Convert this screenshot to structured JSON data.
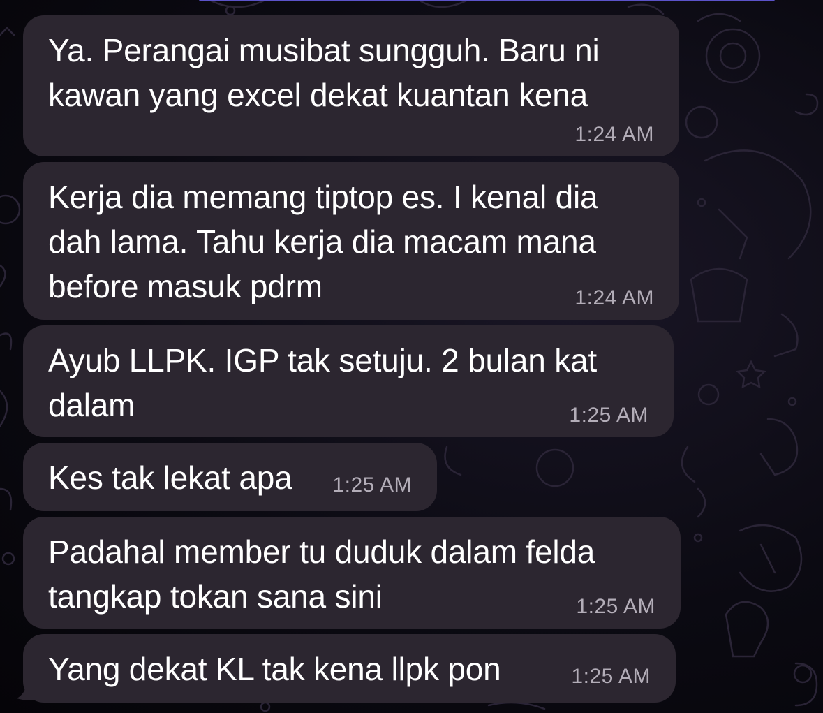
{
  "colors": {
    "bubble": "#2c2630",
    "text": "#ffffff",
    "time": "#b3adb8",
    "accent": "#5b53c9"
  },
  "messages": [
    {
      "text": "Ya. Perangai musibat sungguh. Baru ni\nkawan yang excel dekat kuantan kena",
      "time": "1:24 AM"
    },
    {
      "text": "Kerja dia memang tiptop es. I kenal dia\ndah lama. Tahu kerja dia macam mana\nbefore masuk pdrm",
      "time": "1:24 AM"
    },
    {
      "text": "Ayub LLPK. IGP tak setuju. 2 bulan kat\ndalam",
      "time": "1:25 AM"
    },
    {
      "text": "Kes tak lekat apa",
      "time": "1:25 AM"
    },
    {
      "text": "Padahal member tu duduk dalam felda\ntangkap tokan sana sini",
      "time": "1:25 AM"
    },
    {
      "text": "Yang dekat KL tak kena llpk pon",
      "time": "1:25 AM"
    }
  ]
}
